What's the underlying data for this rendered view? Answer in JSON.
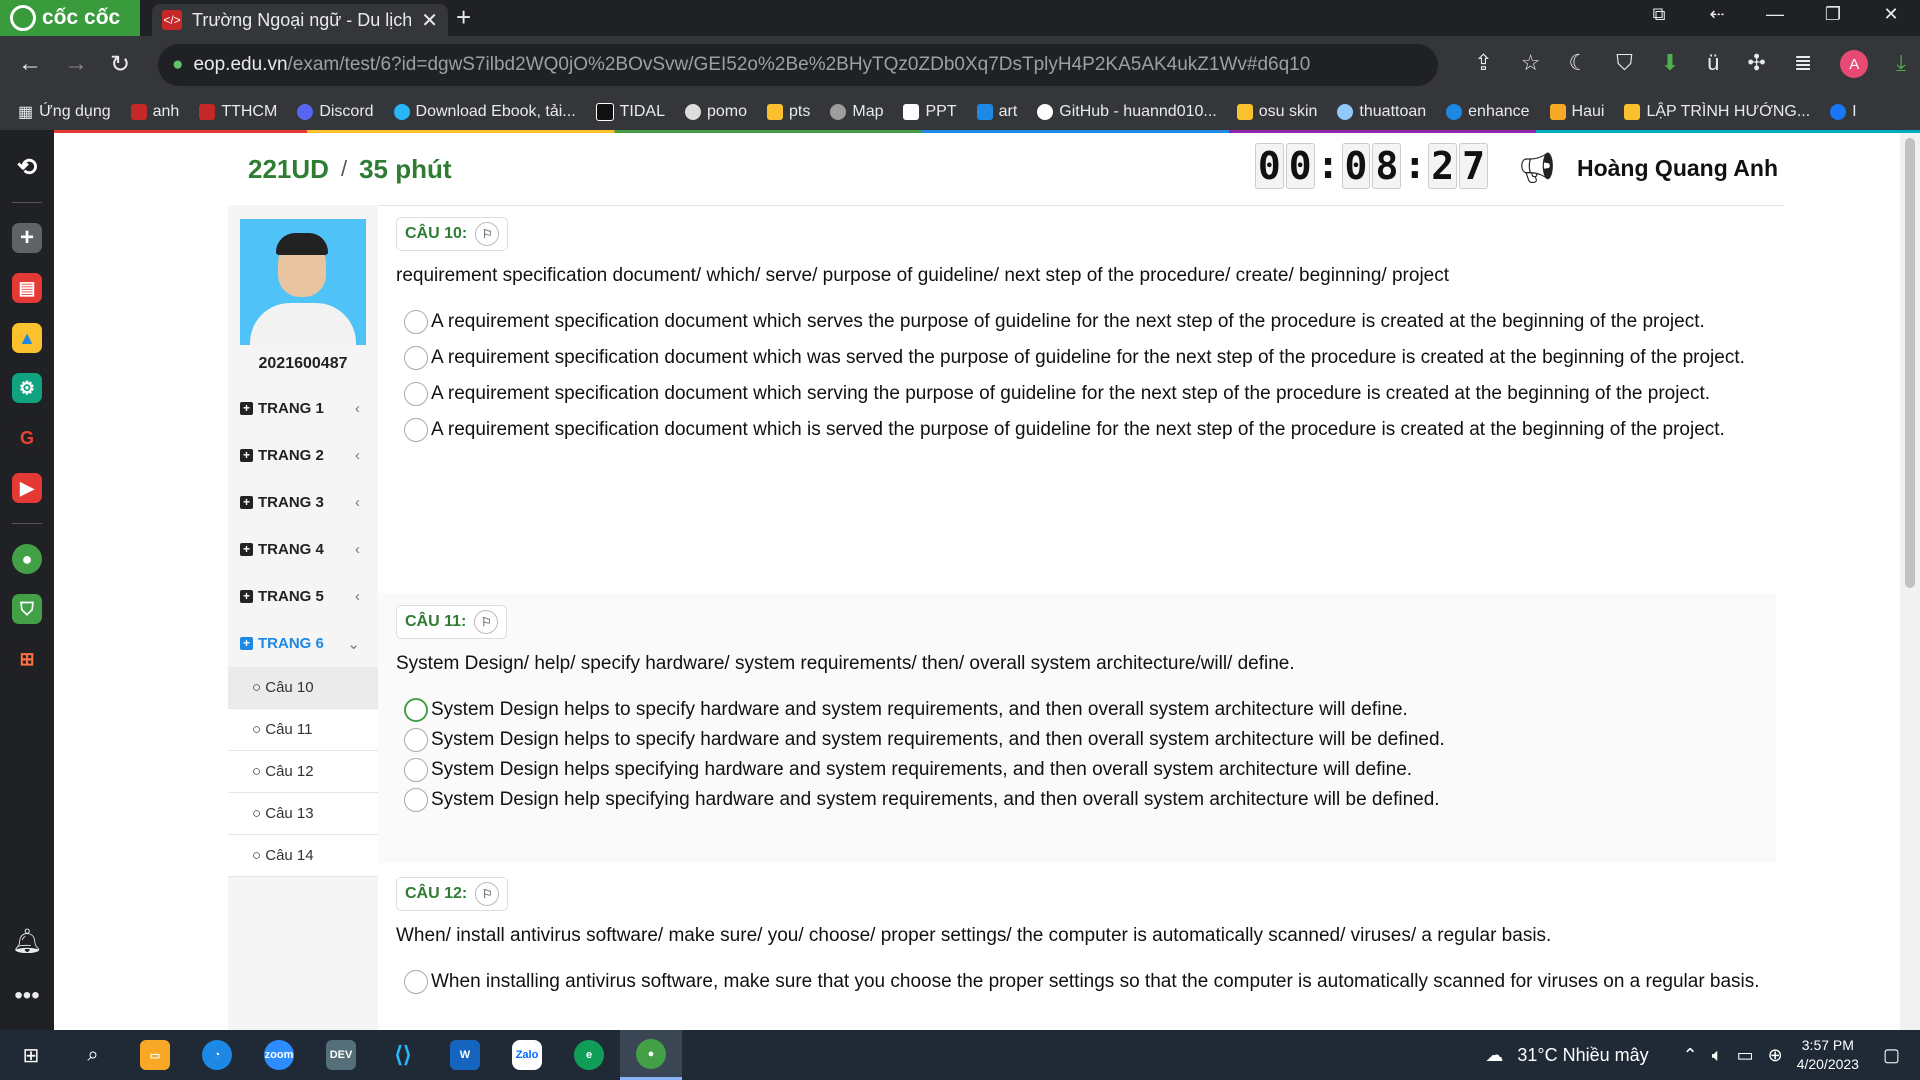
{
  "browser": {
    "brand": "cốc cốc",
    "tab_title": "Trường Ngoại ngữ - Du lịch",
    "url_domain": "eop.edu.vn",
    "url_path": "/exam/test/6?id=dgwS7ilbd2WQ0jO%2BOvSvw/GEI52o%2Be%2BHyTQz0ZDb0Xq7DsTplyH4P2KA5AK4ukZ1Wv#d6q10",
    "avatar_letter": "A",
    "bookmarks": [
      "Ứng dụng",
      "anh",
      "TTHCM",
      "Discord",
      "Download Ebook, tải...",
      "TIDAL",
      "pomo",
      "pts",
      "Map",
      "PPT",
      "art",
      "GitHub - huannd010...",
      "osu skin",
      "thuattoan",
      "enhance",
      "Haui",
      "LẬP TRÌNH HƯỚNG...",
      "I"
    ]
  },
  "exam": {
    "course": "221UD",
    "separator": "/",
    "duration": "35 phút",
    "timer": [
      "0",
      "0",
      ":",
      "0",
      "8",
      ":",
      "2",
      "7"
    ],
    "user_name": "Hoàng Quang Anh",
    "student_id": "2021600487"
  },
  "nav": {
    "pages": [
      "TRANG 1",
      "TRANG 2",
      "TRANG 3",
      "TRANG 4",
      "TRANG 5",
      "TRANG 6"
    ],
    "questions": [
      "Câu 10",
      "Câu 11",
      "Câu 12",
      "Câu 13",
      "Câu 14"
    ]
  },
  "questions": [
    {
      "label": "CÂU 10:",
      "prompt": "requirement specification document/ which/ serve/ purpose of guideline/ next step of the procedure/ create/ beginning/ project",
      "options": [
        "A requirement specification document which serves the purpose of guideline for the next step of the procedure is created at the beginning of the project.",
        "A requirement specification document which was served the purpose of guideline for the next step of the procedure is created at the beginning of the project.",
        "A requirement specification document which serving the purpose of guideline for the next step of the procedure is created at the beginning of the project.",
        "A requirement specification document which is served the purpose of guideline for the next step of the procedure is created at the beginning of the project."
      ]
    },
    {
      "label": "CÂU 11:",
      "prompt": "System Design/ help/ specify hardware/ system requirements/ then/ overall system architecture/will/ define.",
      "options": [
        "System Design helps to specify hardware and system requirements, and then overall system architecture will define.",
        "System Design helps to specify hardware and system requirements, and then overall system architecture will be defined.",
        "System Design helps specifying hardware and system requirements, and then overall system architecture will define.",
        "System Design help specifying hardware and system requirements, and then overall system architecture will be defined."
      ]
    },
    {
      "label": "CÂU 12:",
      "prompt": "When/ install antivirus software/ make sure/ you/ choose/ proper settings/ the computer is automatically scanned/ viruses/ a regular basis.",
      "options": [
        "When installing antivirus software, make sure that you choose the proper settings so that the computer is automatically scanned for viruses on a regular basis."
      ]
    }
  ],
  "taskbar": {
    "weather": "31°C  Nhiều mây",
    "time": "3:57 PM",
    "date": "4/20/2023"
  }
}
